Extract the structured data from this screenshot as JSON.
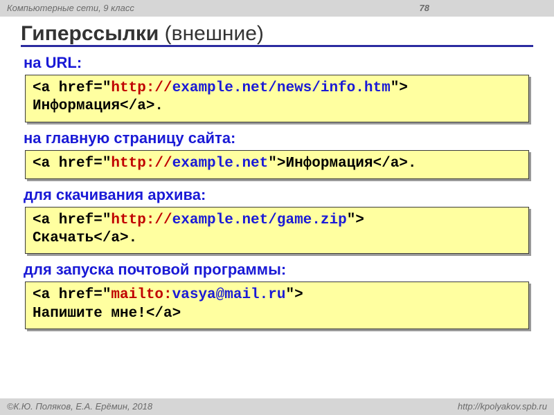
{
  "header": {
    "course": "Компьютерные сети, 9 класс",
    "page": "78"
  },
  "title": {
    "bold": "Гиперссылки",
    "rest": " (внешние)"
  },
  "sections": [
    {
      "heading": "на URL:",
      "code": [
        {
          "t": "<a href=\"",
          "c": ""
        },
        {
          "t": "http://",
          "c": "tok-red"
        },
        {
          "t": "example.net/news/info.htm",
          "c": "tok-blue"
        },
        {
          "t": "\"> ",
          "c": ""
        },
        {
          "t": "\nИнформация</a>.",
          "c": ""
        }
      ]
    },
    {
      "heading": "на главную страницу сайта:",
      "code": [
        {
          "t": "<a href=\"",
          "c": ""
        },
        {
          "t": "http://",
          "c": "tok-red"
        },
        {
          "t": "example.net",
          "c": "tok-blue"
        },
        {
          "t": "\">Информация</a>.",
          "c": ""
        }
      ]
    },
    {
      "heading": "для скачивания архива:",
      "code": [
        {
          "t": "<a href=\"",
          "c": ""
        },
        {
          "t": "http://",
          "c": "tok-red"
        },
        {
          "t": "example.net/game.zip",
          "c": "tok-blue"
        },
        {
          "t": "\"> ",
          "c": ""
        },
        {
          "t": "\nСкачать</a>.",
          "c": ""
        }
      ]
    },
    {
      "heading": "для запуска почтовой программы:",
      "code": [
        {
          "t": "<a href=\"",
          "c": ""
        },
        {
          "t": "mailto:",
          "c": "tok-red"
        },
        {
          "t": "vasya@mail.ru",
          "c": "tok-blue"
        },
        {
          "t": "\"> ",
          "c": ""
        },
        {
          "t": "\nНапишите мне!</a>",
          "c": ""
        }
      ]
    }
  ],
  "footer": {
    "left": "©К.Ю. Поляков, Е.А. Ерёмин, 2018",
    "right": "http://kpolyakov.spb.ru"
  }
}
